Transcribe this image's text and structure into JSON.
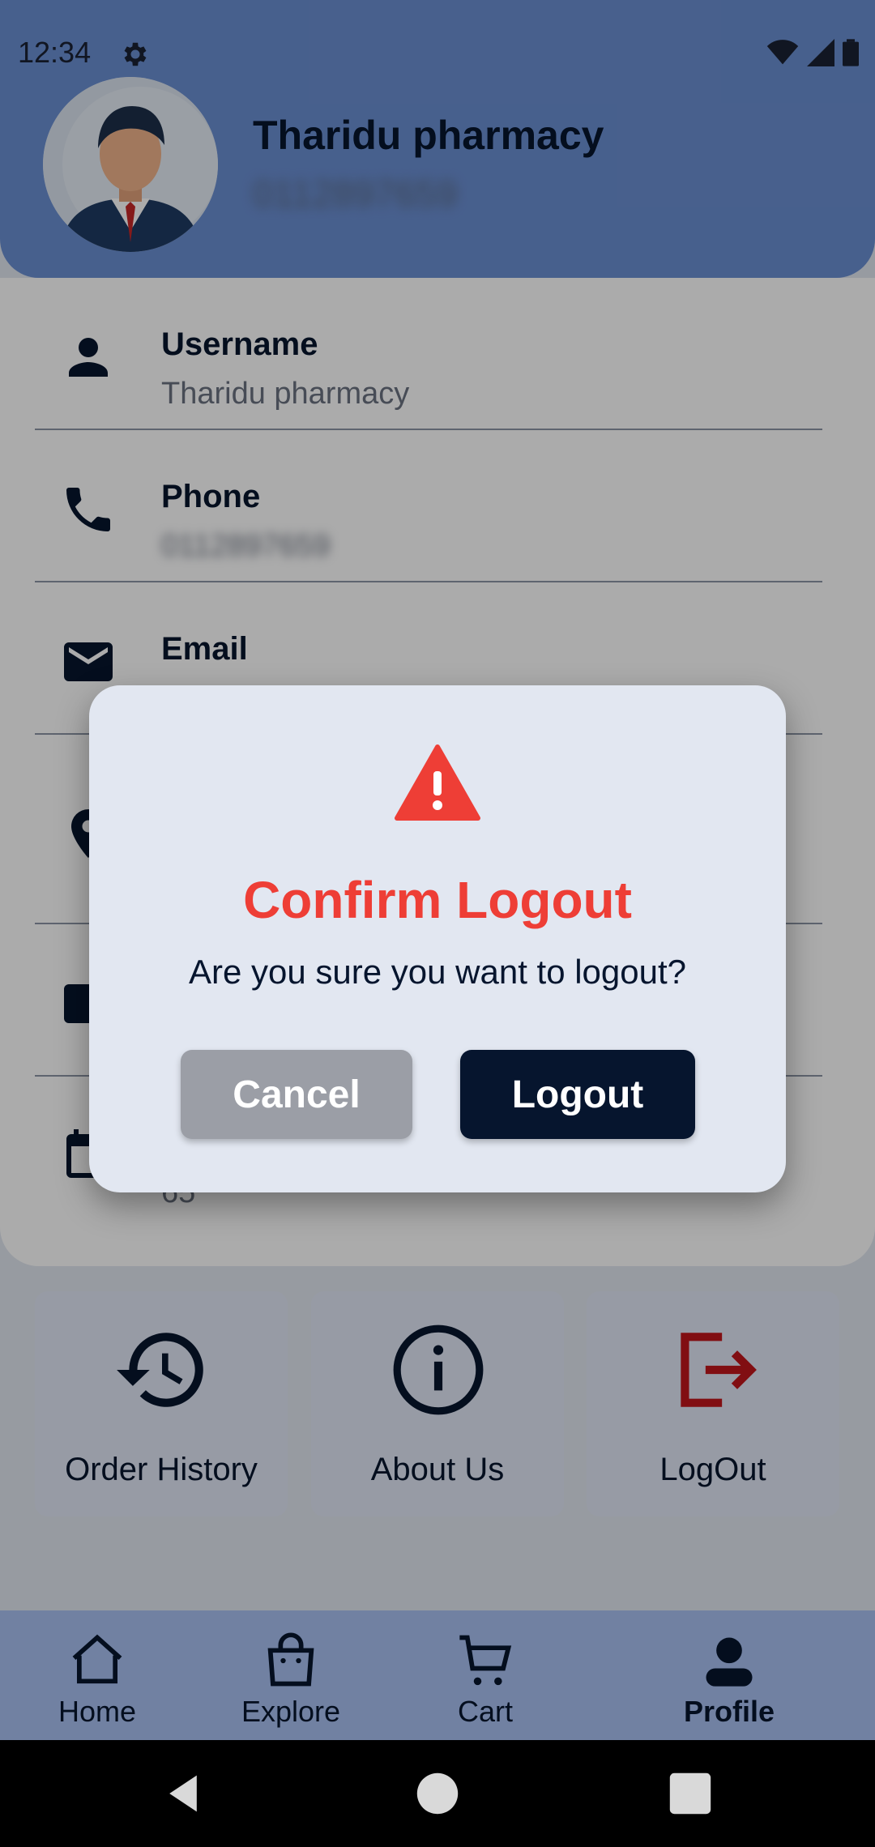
{
  "status_bar": {
    "time": "12:34"
  },
  "profile": {
    "store_name": "Tharidu pharmacy",
    "phone": "0112897659"
  },
  "info_rows": [
    {
      "label": "Username",
      "value": "Tharidu pharmacy"
    },
    {
      "label": "Phone",
      "value": "0112897659"
    },
    {
      "label": "Email",
      "value": ""
    },
    {
      "label": "",
      "value": ""
    },
    {
      "label": "",
      "value": ""
    },
    {
      "label": "",
      "value": "65"
    }
  ],
  "tiles": [
    {
      "label": "Order History",
      "icon": "history-icon"
    },
    {
      "label": "About Us",
      "icon": "info-icon"
    },
    {
      "label": "LogOut",
      "icon": "logout-icon"
    }
  ],
  "bottom_nav": [
    {
      "label": "Home",
      "icon": "home-icon"
    },
    {
      "label": "Explore",
      "icon": "shopping-bag-icon"
    },
    {
      "label": "Cart",
      "icon": "cart-icon"
    },
    {
      "label": "Profile",
      "icon": "person-icon",
      "active": true
    }
  ],
  "dialog": {
    "icon": "warning-icon",
    "title": "Confirm Logout",
    "message": "Are you sure you want to logout?",
    "cancel_label": "Cancel",
    "confirm_label": "Logout"
  },
  "colors": {
    "primary_dark": "#06152e",
    "header_blue": "#6b8fd3",
    "nav_blue": "#a9c1f2",
    "danger_red": "#ee3e36",
    "logout_red": "#c0161b",
    "cancel_gray": "#9b9ea6"
  }
}
